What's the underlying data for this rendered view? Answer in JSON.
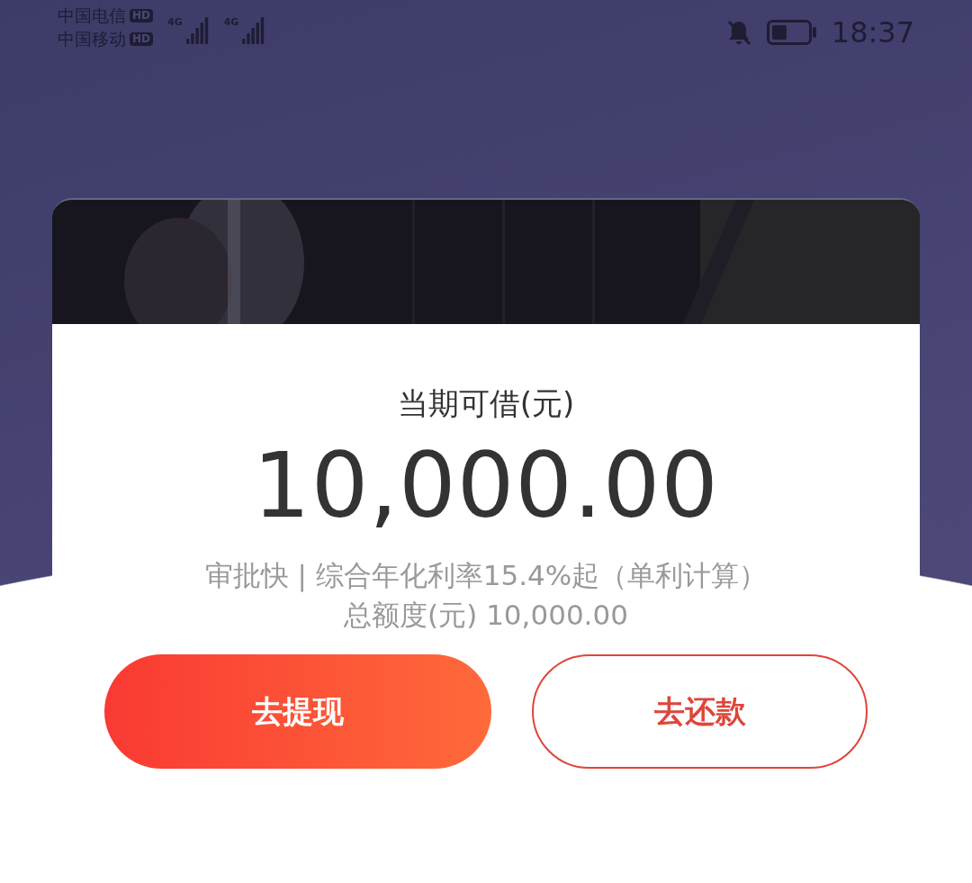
{
  "status_bar": {
    "carriers": [
      {
        "name": "中国电信",
        "badge": "HD"
      },
      {
        "name": "中国移动",
        "badge": "HD"
      }
    ],
    "networks": [
      "4G",
      "4G"
    ],
    "time": "18:37"
  },
  "loan": {
    "title": "当期可借(元)",
    "amount": "10,000.00",
    "description": "审批快 | 综合年化利率15.4%起（单利计算）",
    "total": "总额度(元) 10,000.00"
  },
  "buttons": [
    {
      "label": "去提现",
      "kind": "primary"
    },
    {
      "label": "去还款",
      "kind": "outline"
    }
  ]
}
